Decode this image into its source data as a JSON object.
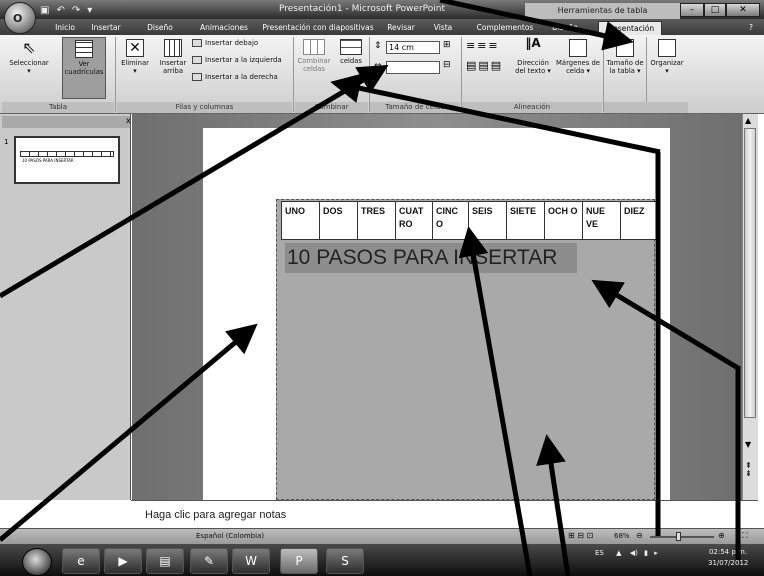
{
  "window": {
    "title": "Presentación1 - Microsoft PowerPoint",
    "contextual_group": "Herramientas de tabla",
    "office_button_label": "O",
    "quick_access": [
      "save-icon",
      "undo-icon",
      "redo-icon",
      "customize-icon"
    ],
    "controls": [
      "minimize-icon",
      "maximize-icon",
      "close-icon"
    ]
  },
  "tabs": [
    {
      "label": "Inicio",
      "active": false
    },
    {
      "label": "Insertar",
      "active": false
    },
    {
      "label": "Diseño",
      "active": false
    },
    {
      "label": "Animaciones",
      "active": false
    },
    {
      "label": "Presentación con diapositivas",
      "active": false
    },
    {
      "label": "Revisar",
      "active": false
    },
    {
      "label": "Vista",
      "active": false
    },
    {
      "label": "Complementos",
      "active": false
    },
    {
      "label": "Diseño",
      "active": false
    },
    {
      "label": "Presentación",
      "active": true
    }
  ],
  "ribbon": {
    "groups": {
      "tabla": "Tabla",
      "filas": "Filas y columnas",
      "combinar": "Combinar",
      "tamano": "Tamaño de celda",
      "alineacion": "Alineación"
    },
    "seleccionar": "Seleccionar",
    "ver_cuadriculas": "Ver cuadrículas",
    "eliminar": "Eliminar",
    "insertar_arriba": "Insertar arriba",
    "insertar_debajo": "Insertar debajo",
    "insertar_izquierda": "Insertar a la izquierda",
    "insertar_derecha": "Insertar a la derecha",
    "combinar_celdas": "Combinar celdas",
    "dividir_celdas": "celdas",
    "altura": "14 cm",
    "direccion_texto": "Dirección del texto",
    "margenes_celda": "Márgenes de celda",
    "tamano_tabla": "Tamaño de la tabla",
    "organizar": "Organizar"
  },
  "slide_pane": {
    "slide_number": "1",
    "thumb_caption": "10 PASOS PARA INSERTAR"
  },
  "slide": {
    "table_cells": [
      "UNO",
      "DOS",
      "TRES",
      "CUAT RO",
      "CINC O",
      "SEIS",
      "SIETE",
      "OCH O",
      "NUE VE",
      "DIEZ"
    ],
    "title": "10 PASOS PARA INSERTAR"
  },
  "notes_placeholder": "Haga clic para agregar notas",
  "status": {
    "language": "Español (Colombia)",
    "zoom": "68%"
  },
  "taskbar": {
    "apps": [
      "ie-icon",
      "media-icon",
      "folder-icon",
      "book-icon",
      "word-icon",
      "powerpoint-icon",
      "skype-icon"
    ],
    "lang": "ES",
    "time": "02:54 p.m.",
    "date": "31/07/2012"
  },
  "colors": {
    "title_bar": "#3a3a3a",
    "ribbon": "#e0e0e0",
    "canvas": "#7a7a7a",
    "table_area": "#a9a9a9",
    "arrow": "#000000"
  }
}
